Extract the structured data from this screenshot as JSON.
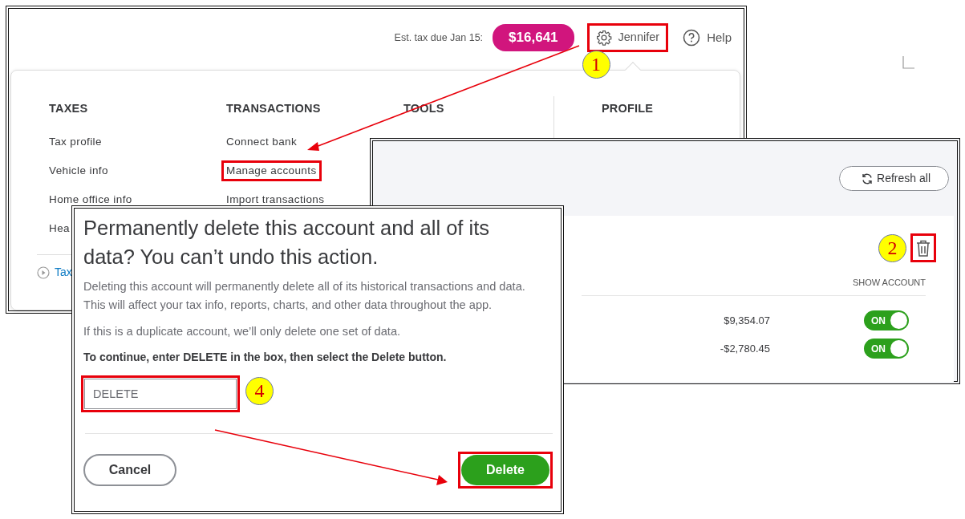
{
  "header": {
    "tax_label": "Est. tax due Jan 15:",
    "tax_amount": "$16,641",
    "user": {
      "name": "Jennifer",
      "highlighted": true,
      "callout": "1"
    },
    "help": "Help"
  },
  "menu": {
    "columns": [
      {
        "heading": "TAXES",
        "items": [
          {
            "label": "Tax profile",
            "highlighted": false
          },
          {
            "label": "Vehicle info",
            "highlighted": false
          },
          {
            "label": "Home office info",
            "highlighted": false
          },
          {
            "label": "Hea",
            "highlighted": false
          }
        ]
      },
      {
        "heading": "TRANSACTIONS",
        "items": [
          {
            "label": "Connect bank",
            "highlighted": false
          },
          {
            "label": "Manage accounts",
            "highlighted": true
          },
          {
            "label": "Import transactions",
            "highlighted": false
          }
        ]
      },
      {
        "heading": "TOOLS"
      },
      {
        "heading": "PROFILE"
      }
    ],
    "footer_link": "Tax"
  },
  "accounts_panel": {
    "refresh_button": "Refresh all",
    "delete": {
      "highlighted": true,
      "callout": "2"
    },
    "column_header": "SHOW ACCOUNT",
    "rows": [
      {
        "amount": "$9,354.07",
        "on": true,
        "toggle_label": "ON"
      },
      {
        "amount": "-$2,780.45",
        "on": true,
        "toggle_label": "ON"
      }
    ]
  },
  "dialog": {
    "title": "Permanently delete this account and all of its data? You can’t undo this action.",
    "paragraphs": [
      "Deleting this account will permanently delete all of its historical transactions and data. This will affect your tax info, reports, charts, and other data throughout the app.",
      "If this is a duplicate account, we’ll only delete one set of data."
    ],
    "instruction": "To continue, enter DELETE in the box, then select the Delete button.",
    "input": {
      "value": "DELETE",
      "highlighted": true,
      "callout": "4"
    },
    "cancel_button": "Cancel",
    "delete_button": {
      "label": "Delete",
      "highlighted": true
    }
  }
}
